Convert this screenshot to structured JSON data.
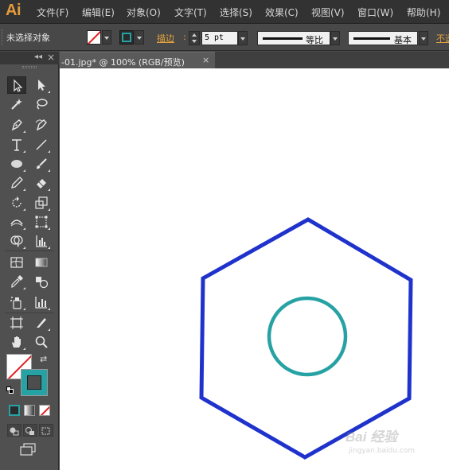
{
  "app": {
    "logo": "Ai"
  },
  "menu": [
    "文件(F)",
    "编辑(E)",
    "对象(O)",
    "文字(T)",
    "选择(S)",
    "效果(C)",
    "视图(V)",
    "窗口(W)",
    "帮助(H)"
  ],
  "control_bar": {
    "selection_status": "未选择对象",
    "stroke_label": "描边",
    "stroke_weight": "5 pt",
    "variable_width_profile": "等比",
    "brush_definition": "基本",
    "opacity_label": "不透明度"
  },
  "document": {
    "tab_title": "-01.jpg* @ 100% (RGB/预览)",
    "close_glyph": "×"
  },
  "tools_panel": {
    "collapse_glyph": "◂◂",
    "close_glyph": "×"
  },
  "colors": {
    "accent": "#e5a33e",
    "hexagon_stroke": "#1f33cc",
    "circle_stroke": "#27a2a4",
    "stroke_swatch": "#27a2a4",
    "canvas": "#ffffff"
  },
  "artwork": {
    "stroke_weight_pt": 5,
    "shapes": [
      "hexagon",
      "circle"
    ]
  },
  "watermark": {
    "brand": "Bai 经验",
    "url": "jingyan.baidu.com"
  }
}
